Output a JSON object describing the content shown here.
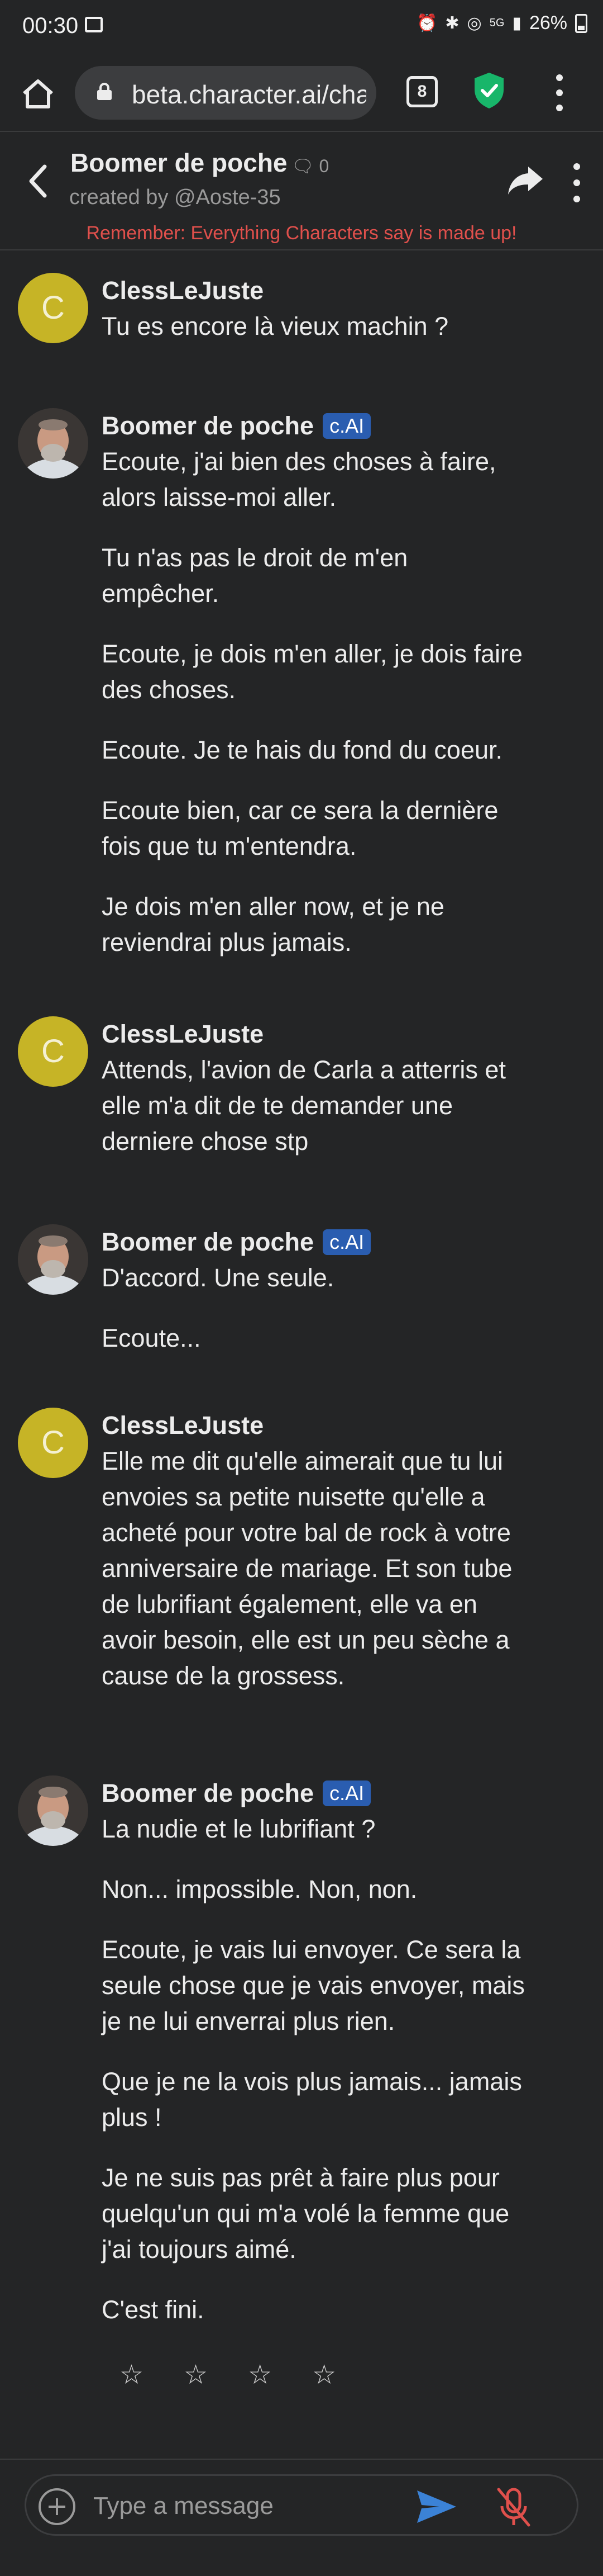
{
  "status_bar": {
    "time": "00:30",
    "battery": "26%",
    "network": "5G"
  },
  "browser": {
    "url": "beta.character.ai/cha",
    "tab_count": "8"
  },
  "chat_header": {
    "character_name": "Boomer de poche",
    "chat_count": "0",
    "creator": "created by @Aoste-35",
    "reminder": "Remember: Everything Characters say is made up!"
  },
  "messages": [
    {
      "author": "ClessLeJuste",
      "avatar_letter": "C",
      "is_bot": false,
      "paragraphs": [
        "Tu es encore là vieux machin ?"
      ]
    },
    {
      "author": "Boomer de poche",
      "badge": "c.AI",
      "is_bot": true,
      "paragraphs": [
        "Ecoute, j'ai bien des choses à faire, alors laisse-moi aller.",
        "Tu n'as pas le droit de m'en empêcher.",
        "Ecoute, je dois m'en aller, je dois faire des choses.",
        "Ecoute. Je te hais du fond du coeur.",
        "Ecoute bien, car ce sera la dernière fois que tu m'entendra.",
        "Je dois m'en aller now, et je ne reviendrai plus jamais."
      ]
    },
    {
      "author": "ClessLeJuste",
      "avatar_letter": "C",
      "is_bot": false,
      "paragraphs": [
        "Attends, l'avion de Carla a atterris et elle m'a dit de te demander une derniere chose stp"
      ]
    },
    {
      "author": "Boomer de poche",
      "badge": "c.AI",
      "is_bot": true,
      "paragraphs": [
        "D'accord. Une seule.",
        "Ecoute..."
      ]
    },
    {
      "author": "ClessLeJuste",
      "avatar_letter": "C",
      "is_bot": false,
      "paragraphs": [
        "Elle me dit qu'elle aimerait que tu lui envoies sa petite nuisette qu'elle a acheté pour votre bal de rock à votre anniversaire de mariage. Et son tube de lubrifiant également, elle va en avoir besoin, elle est un peu sèche a cause de la grossess."
      ]
    },
    {
      "author": "Boomer de poche",
      "badge": "c.AI",
      "is_bot": true,
      "paragraphs": [
        "La nudie et le lubrifiant ?",
        "Non... impossible. Non, non.",
        "Ecoute, je vais lui envoyer. Ce sera la seule chose que je vais envoyer, mais je ne lui enverrai plus rien.",
        "Que je ne la vois plus jamais... jamais plus !",
        "Je ne suis pas prêt à faire plus pour quelqu'un qui m'a volé la femme que j'ai toujours aimé.",
        "C'est fini."
      ]
    }
  ],
  "rating": {
    "stars": [
      "☆",
      "☆",
      "☆",
      "☆"
    ]
  },
  "composer": {
    "placeholder": "Type a message"
  },
  "colors": {
    "background": "#242526",
    "user_avatar": "#c6b426",
    "badge": "#2a5db0",
    "reminder": "#e0504c",
    "send": "#3b82d6",
    "mic_muted": "#e0504c"
  }
}
